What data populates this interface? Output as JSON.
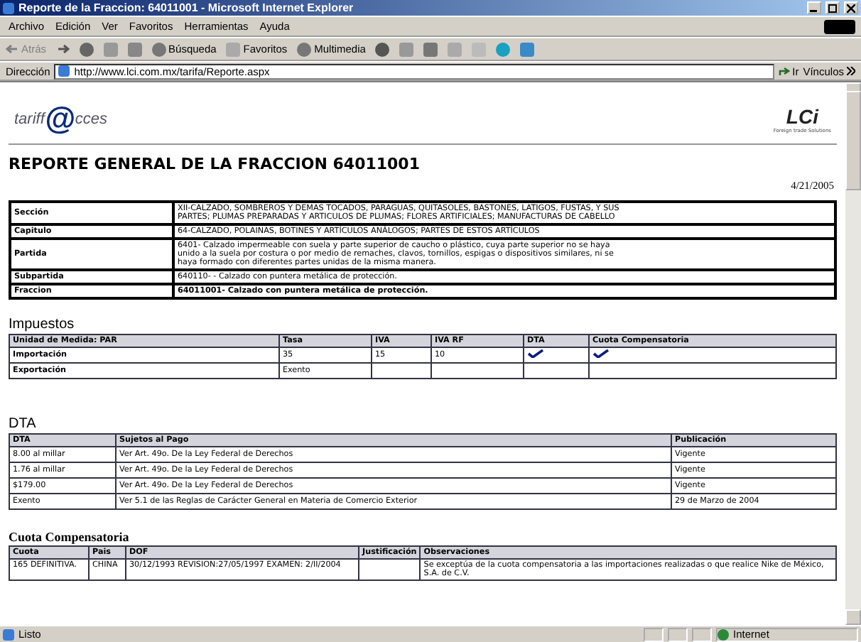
{
  "window": {
    "title": "Reporte de la Fraccion: 64011001 - Microsoft Internet Explorer"
  },
  "menu": [
    "Archivo",
    "Edición",
    "Ver",
    "Favoritos",
    "Herramientas",
    "Ayuda"
  ],
  "toolbar": {
    "back": "Atrás",
    "search": "Búsqueda",
    "favorites": "Favoritos",
    "media": "Multimedia"
  },
  "address_bar": {
    "label": "Dirección",
    "url": "http://www.lci.com.mx/tarifa/Reporte.aspx",
    "go": "Ir",
    "links": "Vínculos"
  },
  "logo": {
    "left_a": "tariff",
    "left_at": "@",
    "left_b": "cces",
    "right": "LCi",
    "right_tagline": "Foreign trade Solutions"
  },
  "title": "REPORTE GENERAL DE LA FRACCION 64011001",
  "date": "4/21/2005",
  "classification": [
    {
      "label": "Sección",
      "text": "XII-CALZADO, SOMBREROS Y DEMAS TOCADOS, PARAGUAS, QUITASOLES, BASTONES, LATIGOS, FUSTAS, Y SUS PARTES; PLUMAS PREPARADAS Y ARTICULOS DE PLUMAS; FLORES ARTIFICIALES; MANUFACTURAS DE CABELLO",
      "bold": false
    },
    {
      "label": "Capitulo",
      "text": "64-CALZADO, POLAINAS, BOTINES Y ARTÍCULOS ANÁLOGOS; PARTES DE ESTOS ARTÍCULOS",
      "bold": false
    },
    {
      "label": "Partida",
      "text": "6401- Calzado impermeable con suela y parte superior de caucho o plástico, cuya parte superior no se haya unido a la suela por costura o por medio de remaches, clavos, tornillos, espigas o dispositivos similares, ni se haya formado con diferentes partes unidas de la misma manera.",
      "bold": false
    },
    {
      "label": "Subpartida",
      "text": "640110- - Calzado con puntera metálica de protección.",
      "bold": false
    },
    {
      "label": "Fraccion",
      "text": "64011001- Calzado con puntera metálica de protección.",
      "bold": true
    }
  ],
  "impuestos": {
    "heading": "Impuestos",
    "columns": [
      "Unidad de Medida: PAR",
      "Tasa",
      "IVA",
      "IVA RF",
      "DTA",
      "Cuota Compensatoria"
    ],
    "rows": [
      {
        "label": "Importación",
        "tasa": "35",
        "iva": "15",
        "iva_rf": "10",
        "dta_checked": true,
        "cuota_checked": true
      },
      {
        "label": "Exportación",
        "tasa": "Exento",
        "iva": "",
        "iva_rf": "",
        "dta_checked": false,
        "cuota_checked": false
      }
    ]
  },
  "dta": {
    "heading": "DTA",
    "columns": [
      "DTA",
      "Sujetos al Pago",
      "Publicación"
    ],
    "rows": [
      [
        "8.00 al millar",
        "Ver Art. 49o. De la Ley Federal de Derechos",
        "Vigente"
      ],
      [
        "1.76 al millar",
        "Ver Art. 49o. De la Ley Federal de Derechos",
        "Vigente"
      ],
      [
        "$179.00",
        "Ver Art. 49o. De la Ley Federal de Derechos",
        "Vigente"
      ],
      [
        "Exento",
        "Ver 5.1 de las Reglas de Carácter General en Materia de Comercio Exterior",
        "29 de Marzo de 2004"
      ]
    ]
  },
  "cuota": {
    "heading": "Cuota Compensatoria",
    "columns": [
      "Cuota",
      "Pais",
      "DOF",
      "Justificación",
      "Observaciones"
    ],
    "rows": [
      [
        "165 DEFINITIVA.",
        "CHINA",
        "30/12/1993 REVISION:27/05/1997 EXAMEN: 2/II/2004",
        "",
        "Se exceptúa de la cuota compensatoria a las importaciones realizadas o que realice Nike de México, S.A. de C.V."
      ]
    ]
  },
  "status_bar": {
    "text": "Listo",
    "zone": "Internet"
  }
}
